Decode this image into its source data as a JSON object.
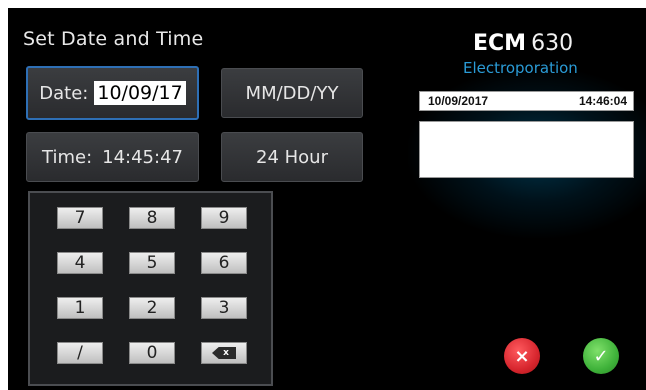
{
  "screen": {
    "title": "Set Date and Time"
  },
  "date_field": {
    "label": "Date:",
    "value": "10/09/17"
  },
  "format_button": {
    "label": "MM/DD/YY"
  },
  "time_field": {
    "label": "Time:",
    "value": "14:45:47"
  },
  "hour_mode_button": {
    "label": "24 Hour"
  },
  "keypad": {
    "keys": [
      "7",
      "8",
      "9",
      "4",
      "5",
      "6",
      "1",
      "2",
      "3",
      "/",
      "0"
    ],
    "backspace_icon": "backspace-icon"
  },
  "brand": {
    "name": "ECM",
    "model": "630",
    "subtitle": "Electroporation"
  },
  "status_bar": {
    "date": "10/09/2017",
    "time": "14:46:04"
  },
  "actions": {
    "cancel_symbol": "×",
    "confirm_symbol": "✓",
    "cancel_color": "#d7262e",
    "confirm_color": "#3fb23a"
  },
  "colors": {
    "background": "#000000",
    "accent": "#2a9bd6",
    "selected_border": "#2e6fb5"
  }
}
